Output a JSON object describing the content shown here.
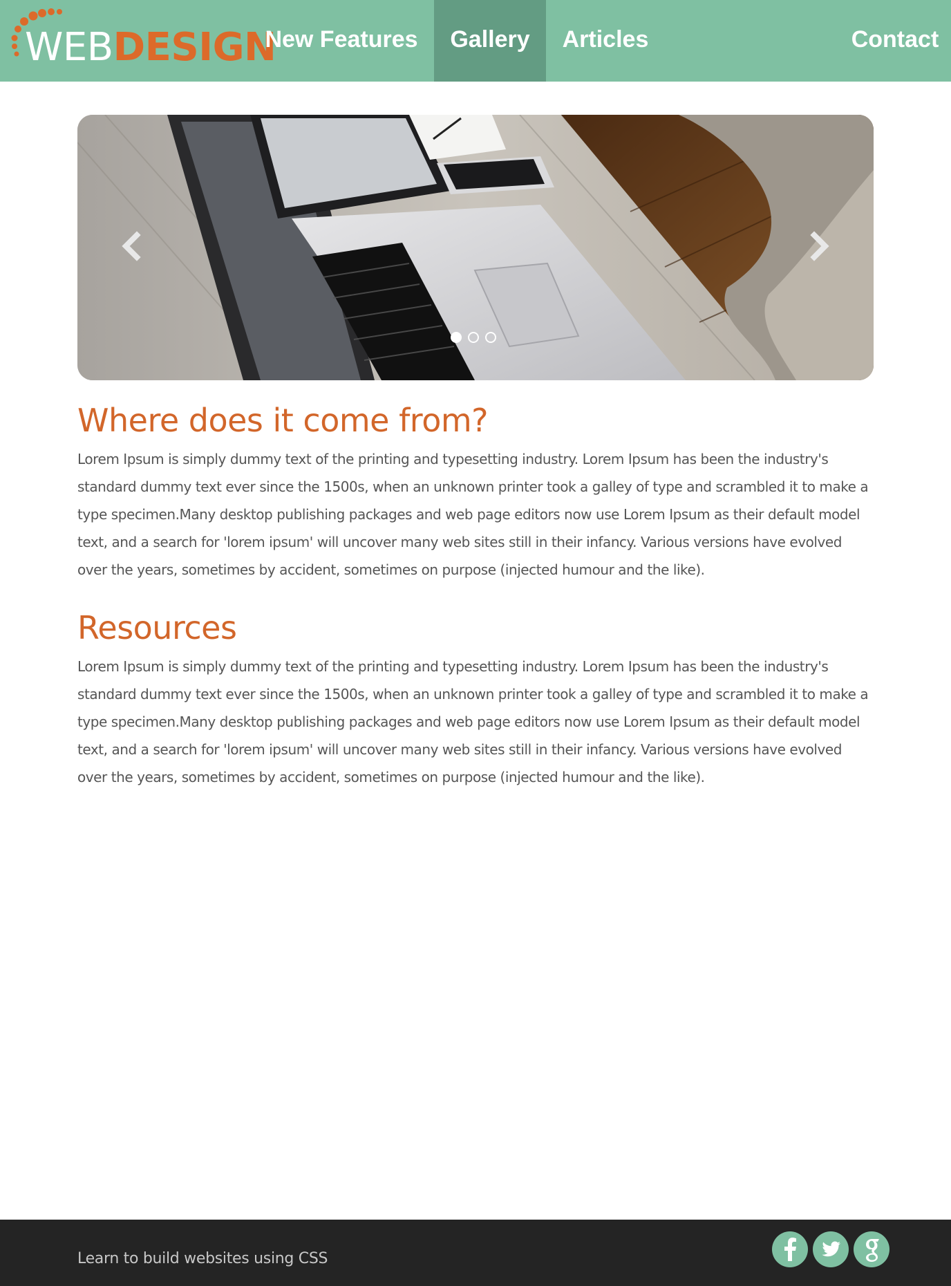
{
  "brand": {
    "logo_part1": "WEB",
    "logo_part2": "DESIGN",
    "logo_color": "#dc6a2a"
  },
  "nav": {
    "background": "#7fc0a2",
    "active_background": "#639c83",
    "items": [
      {
        "label": "New Features",
        "active": false
      },
      {
        "label": "Gallery",
        "active": true
      },
      {
        "label": "Articles",
        "active": false
      },
      {
        "label": "Contact",
        "active": false
      }
    ]
  },
  "carousel": {
    "image": "laptop-tablet-phone-on-wooden-desk",
    "prev_icon": "chevron-left-icon",
    "next_icon": "chevron-right-icon",
    "slide_count": 3,
    "active_slide": 1
  },
  "sections": [
    {
      "heading": "Where does it come from?",
      "body": "Lorem Ipsum is simply dummy text of the printing and typesetting industry. Lorem Ipsum has been the industry's standard dummy text ever since the 1500s, when an unknown printer took a galley of type and scrambled it to make a type specimen.Many desktop publishing packages and web page editors now use Lorem Ipsum as their default model text, and a search for 'lorem ipsum' will uncover many web sites still in their infancy. Various versions have evolved over the years, sometimes by accident, sometimes on purpose (injected humour and the like)."
    },
    {
      "heading": "Resources",
      "body": "Lorem Ipsum is simply dummy text of the printing and typesetting industry. Lorem Ipsum has been the industry's standard dummy text ever since the 1500s, when an unknown printer took a galley of type and scrambled it to make a type specimen.Many desktop publishing packages and web page editors now use Lorem Ipsum as their default model text, and a search for 'lorem ipsum' will uncover many web sites still in their infancy. Various versions have evolved over the years, sometimes by accident, sometimes on purpose (injected humour and the like)."
    }
  ],
  "footer": {
    "text": "Learn to build websites using CSS",
    "social": [
      "facebook-icon",
      "twitter-icon",
      "google-plus-icon"
    ],
    "social_color": "#7fc0a2"
  }
}
